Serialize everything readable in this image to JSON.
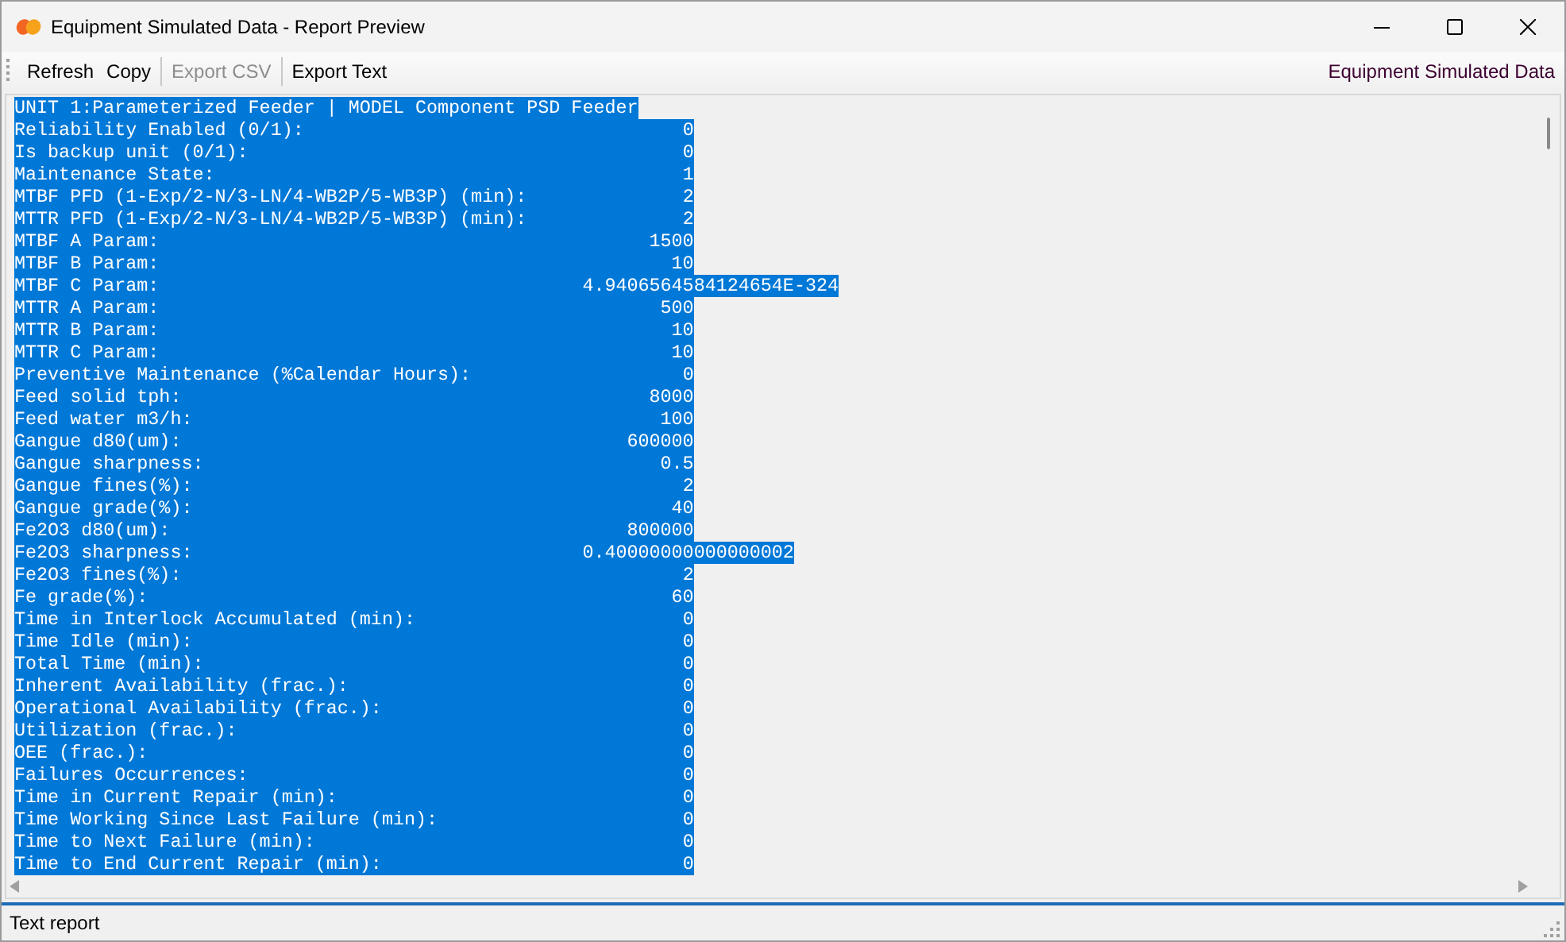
{
  "window": {
    "title": "Equipment Simulated Data - Report Preview"
  },
  "toolbar": {
    "buttons": [
      {
        "label": "Refresh",
        "disabled": false
      },
      {
        "label": "Copy",
        "disabled": false
      },
      {
        "label": "Export CSV",
        "disabled": true
      },
      {
        "label": "Export Text",
        "disabled": false
      }
    ],
    "caption": "Equipment Simulated Data"
  },
  "report": {
    "selected": true,
    "header": "UNIT 1:Parameterized Feeder | MODEL Component PSD Feeder",
    "lines": [
      {
        "label": "Reliability Enabled (0/1):",
        "value": "0"
      },
      {
        "label": "Is backup unit (0/1):",
        "value": "0"
      },
      {
        "label": "Maintenance State:",
        "value": "1"
      },
      {
        "label": "MTBF PFD (1-Exp/2-N/3-LN/4-WB2P/5-WB3P) (min):",
        "value": "2"
      },
      {
        "label": "MTTR PFD (1-Exp/2-N/3-LN/4-WB2P/5-WB3P) (min):",
        "value": "2"
      },
      {
        "label": "MTBF A Param:",
        "value": "1500"
      },
      {
        "label": "MTBF B Param:",
        "value": "10"
      },
      {
        "label": "MTBF C Param:",
        "value": "4.9406564584124654E-324"
      },
      {
        "label": "MTTR A Param:",
        "value": "500"
      },
      {
        "label": "MTTR B Param:",
        "value": "10"
      },
      {
        "label": "MTTR C Param:",
        "value": "10"
      },
      {
        "label": "Preventive Maintenance (%Calendar Hours):",
        "value": "0"
      },
      {
        "label": "Feed solid tph:",
        "value": "8000"
      },
      {
        "label": "Feed water m3/h:",
        "value": "100"
      },
      {
        "label": "Gangue d80(um):",
        "value": "600000"
      },
      {
        "label": "Gangue sharpness:",
        "value": "0.5"
      },
      {
        "label": "Gangue fines(%):",
        "value": "2"
      },
      {
        "label": "Gangue grade(%):",
        "value": "40"
      },
      {
        "label": "Fe2O3 d80(um):",
        "value": "800000"
      },
      {
        "label": "Fe2O3 sharpness:",
        "value": "0.40000000000000002"
      },
      {
        "label": "Fe2O3 fines(%):",
        "value": "2"
      },
      {
        "label": "Fe grade(%):",
        "value": "60"
      },
      {
        "label": "Time in Interlock Accumulated (min):",
        "value": "0"
      },
      {
        "label": "Time Idle (min):",
        "value": "0"
      },
      {
        "label": "Total Time (min):",
        "value": "0"
      },
      {
        "label": "Inherent Availability (frac.):",
        "value": "0"
      },
      {
        "label": "Operational Availability (frac.):",
        "value": "0"
      },
      {
        "label": "Utilization (frac.):",
        "value": "0"
      },
      {
        "label": "OEE (frac.):",
        "value": "0"
      },
      {
        "label": "Failures Occurrences:",
        "value": "0"
      },
      {
        "label": "Time in Current Repair (min):",
        "value": "0"
      },
      {
        "label": "Time Working Since Last Failure (min):",
        "value": "0"
      },
      {
        "label": "Time to Next Failure (min):",
        "value": "0"
      },
      {
        "label": "Time to End Current Repair (min):",
        "value": "0"
      }
    ]
  },
  "status_bar": {
    "text": "Text report"
  }
}
